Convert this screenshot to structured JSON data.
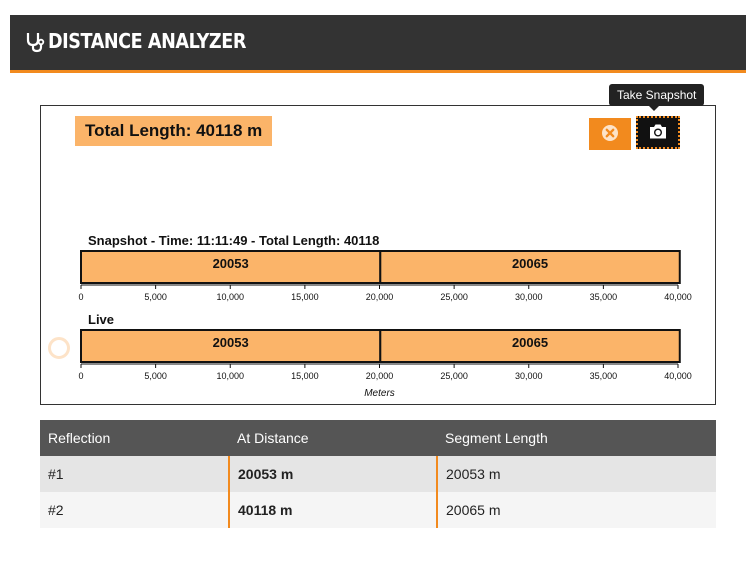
{
  "app": {
    "title": "DISTANCE ANALYZER",
    "logo_icon": "stethoscope-icon"
  },
  "accent": "#f28a1e",
  "bar_fill": "#fbb469",
  "panel": {
    "total_length": "Total Length: 40118 m",
    "clear_icon": "close-circle-icon",
    "snapshot_icon": "camera-icon",
    "snapshot_tooltip": "Take Snapshot"
  },
  "chart_data": {
    "type": "bar",
    "xlabel": "Meters",
    "xlim": [
      0,
      40000
    ],
    "ticks": [
      "0",
      "5,000",
      "10,000",
      "15,000",
      "20,000",
      "25,000",
      "30,000",
      "35,000",
      "40,000"
    ],
    "tick_values": [
      0,
      5000,
      10000,
      15000,
      20000,
      25000,
      30000,
      35000,
      40000
    ],
    "bars": [
      {
        "title": "Snapshot - Time: 11:11:49 - Total Length: 40118",
        "segments": [
          {
            "label": "20053",
            "length": 20053
          },
          {
            "label": "20065",
            "length": 20065
          }
        ]
      },
      {
        "title": "Live",
        "segments": [
          {
            "label": "20053",
            "length": 20053
          },
          {
            "label": "20065",
            "length": 20065
          }
        ]
      }
    ]
  },
  "table": {
    "headers": [
      "Reflection",
      "At Distance",
      "Segment Length"
    ],
    "rows": [
      [
        "#1",
        "20053 m",
        "20053 m"
      ],
      [
        "#2",
        "40118 m",
        "20065 m"
      ]
    ]
  }
}
